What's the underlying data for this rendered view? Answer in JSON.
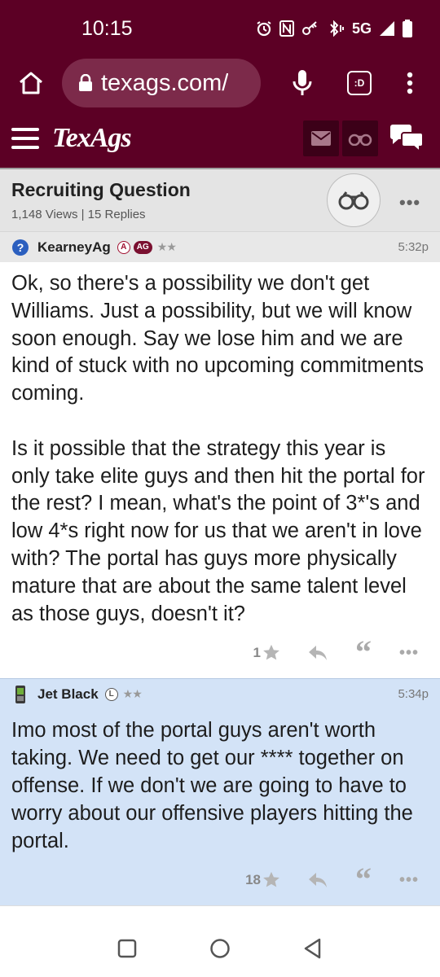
{
  "status_bar": {
    "time": "10:15",
    "network": "5G"
  },
  "browser": {
    "url": "texags.com/",
    "tabs_label": ":D"
  },
  "site": {
    "logo": "TexAgs"
  },
  "thread": {
    "title": "Recruiting Question",
    "meta": "1,148 Views | 15 Replies"
  },
  "posts": [
    {
      "username": "KearneyAg",
      "badge_letter": "A",
      "badge_pill": "AG",
      "stars": "★★",
      "time": "5:32p",
      "body": "Ok, so there's a possibility we don't get Williams. Just a possibility, but we will know soon enough. Say we lose him and we are kind of stuck with no upcoming commitments coming.\n\nIs it possible that the strategy this year is only take elite guys and then hit the portal for the rest? I mean, what's the point of 3*'s and low 4*s right now for us that we aren't in love with? The portal has guys more physically mature that are about the same talent level as those guys, doesn't it?",
      "likes": "1"
    },
    {
      "username": "Jet Black",
      "badge_letter": "L",
      "stars": "★★",
      "time": "5:34p",
      "body": "Imo most of the portal guys aren't worth taking. We need to get our **** together on offense. If we don't we are going to have to worry about our offensive players hitting the portal.",
      "likes": "18"
    }
  ],
  "colors": {
    "brand": "#5c0025",
    "highlight": "#d3e3f7"
  }
}
